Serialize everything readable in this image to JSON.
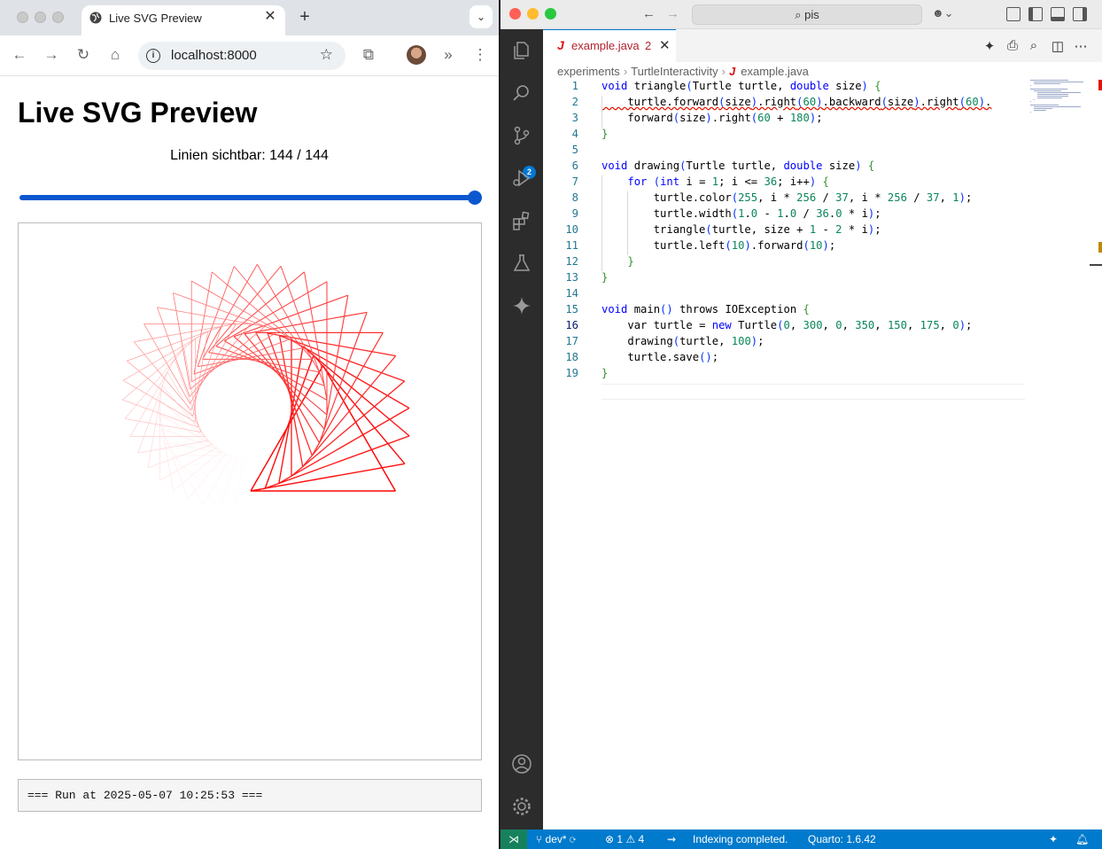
{
  "browser": {
    "tab_title": "Live SVG Preview",
    "url": "localhost:8000",
    "page": {
      "heading": "Live SVG Preview",
      "lines_label": "Linien sichtbar:",
      "lines_visible": "144",
      "lines_total": "144",
      "slider_value_fraction": 1.0,
      "log_text": "=== Run at 2025-05-07 10:25:53 ==="
    }
  },
  "vscode": {
    "search": "pis",
    "tab": {
      "name": "example.java",
      "problems": "2",
      "lang_glyph": "J"
    },
    "breadcrumbs": [
      "experiments",
      "TurtleInteractivity",
      "example.java"
    ],
    "active_line": 16,
    "code_lines": [
      "void triangle(Turtle turtle, double size) {",
      "    turtle.forward(size).right(60).backward(size).right(60).",
      "    forward(size).right(60 + 180);",
      "}",
      "",
      "void drawing(Turtle turtle, double size) {",
      "    for (int i = 1; i <= 36; i++) {",
      "        turtle.color(255, i * 256 / 37, i * 256 / 37, 1);",
      "        turtle.width(1.0 - 1.0 / 36.0 * i);",
      "        triangle(turtle, size + 1 - 2 * i);",
      "        turtle.left(10).forward(10);",
      "    }",
      "}",
      "",
      "void main() throws IOException {",
      "    var turtle = new Turtle(0, 300, 0, 350, 150, 175, 0);",
      "    drawing(turtle, 100);",
      "    turtle.save();",
      "}"
    ],
    "scm_badge": "2",
    "status": {
      "branch": "dev*",
      "errors": "1",
      "warnings": "4",
      "indexing": "Indexing completed.",
      "quarto": "Quarto: 1.6.42"
    }
  },
  "colors": {
    "accent": "#0b57d0",
    "vscode_blue": "#007acc",
    "turtle_red": "#ff0000"
  }
}
